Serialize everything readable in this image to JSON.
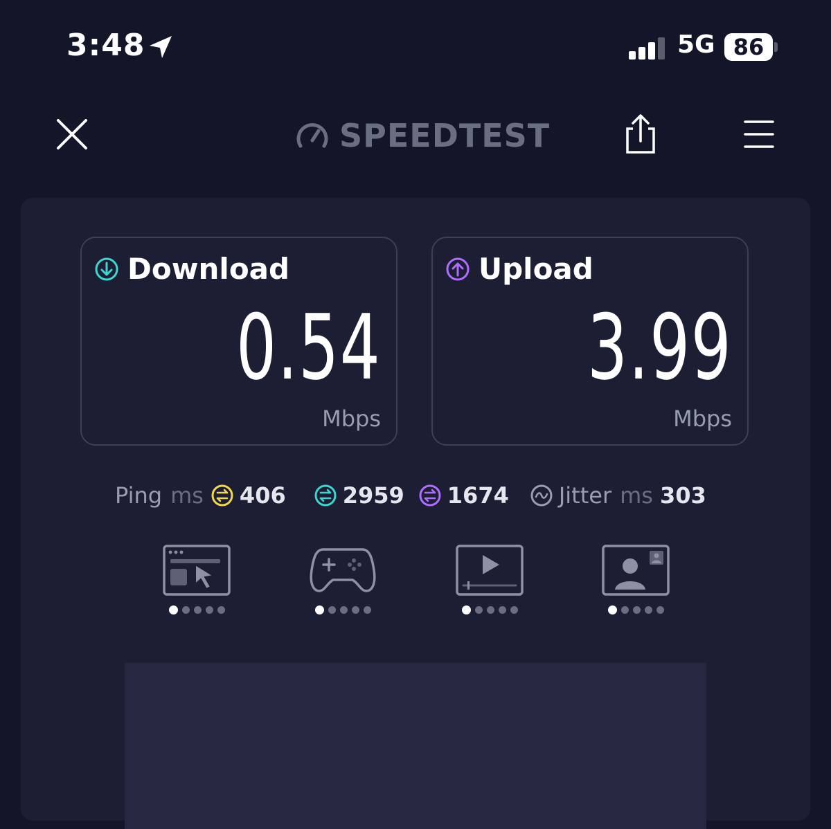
{
  "status_bar": {
    "time": "3:48",
    "network": "5G",
    "battery": "86"
  },
  "header": {
    "logo_text": "SPEEDTEST"
  },
  "download": {
    "label": "Download",
    "value": "0.54",
    "unit": "Mbps",
    "color": "#3dd6d0"
  },
  "upload": {
    "label": "Upload",
    "value": "3.99",
    "unit": "Mbps",
    "color": "#b06cff"
  },
  "ping": {
    "label": "Ping",
    "unit": "ms",
    "idle": "406",
    "download": "2959",
    "upload": "1674",
    "idle_color": "#f5d84a",
    "download_color": "#3dd6d0",
    "upload_color": "#b06cff"
  },
  "jitter": {
    "label": "Jitter",
    "unit": "ms",
    "value": "303"
  },
  "activities": [
    {
      "icon": "web-browsing-icon",
      "rating_of_5": 1
    },
    {
      "icon": "gaming-icon",
      "rating_of_5": 1
    },
    {
      "icon": "video-streaming-icon",
      "rating_of_5": 1
    },
    {
      "icon": "video-chat-icon",
      "rating_of_5": 1
    }
  ]
}
